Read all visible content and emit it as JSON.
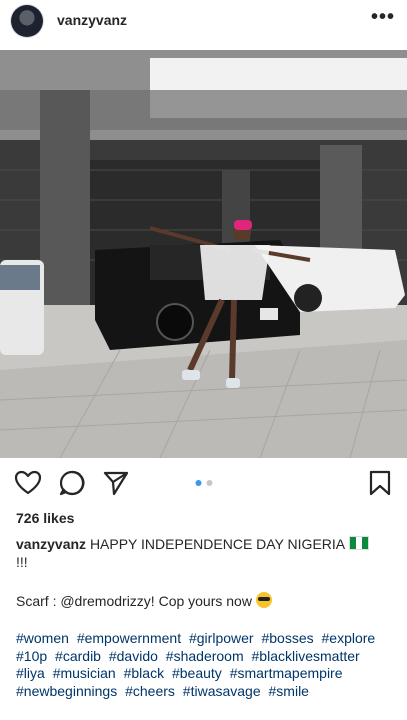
{
  "post": {
    "username": "vanzyvanz",
    "more_icon": "more-horizontal-icon",
    "likes": "726 likes",
    "caption_user": "vanzyvanz",
    "caption_text": "HAPPY INDEPENDENCE DAY NIGERIA",
    "caption_tail": "!!!",
    "scarf_text": "Scarf : @dremodrizzy! Cop yours now",
    "hashtags": [
      "#women",
      "#empowernment",
      "#girlpower",
      "#bosses",
      "#explore",
      "#10p",
      "#cardib",
      "#davido",
      "#shaderoom",
      "#blacklivesmatter",
      "#liya",
      "#musician",
      "#black",
      "#beauty",
      "#smartmapempire",
      "#newbeginnings",
      "#cheers",
      "#tiwasavage",
      "#smile"
    ],
    "carousel": {
      "count": 2,
      "active": 1
    },
    "accent": "#3897f0"
  }
}
